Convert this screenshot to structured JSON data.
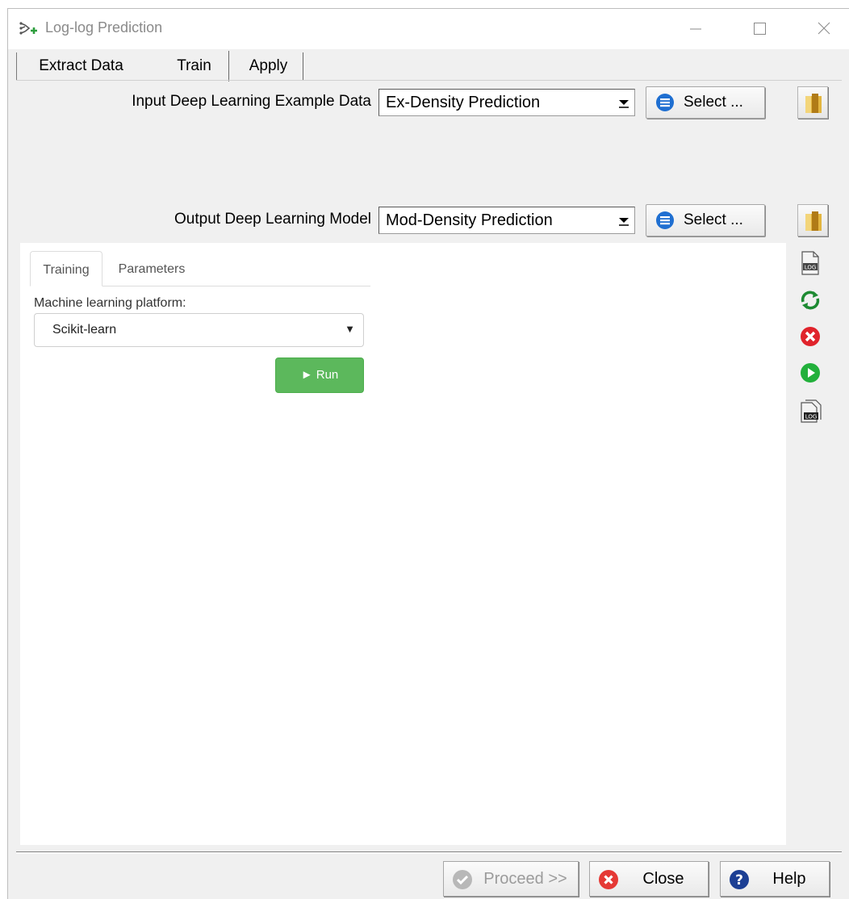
{
  "window": {
    "title": "Log-log Prediction"
  },
  "tabs": [
    {
      "label": "Extract Data"
    },
    {
      "label": "Train"
    },
    {
      "label": "Apply"
    }
  ],
  "input_row": {
    "label": "Input Deep Learning Example Data",
    "value": "Ex-Density Prediction",
    "select_label": "Select ..."
  },
  "output_row": {
    "label": "Output Deep Learning Model",
    "value": "Mod-Density Prediction",
    "select_label": "Select ..."
  },
  "subtabs": [
    {
      "label": "Training"
    },
    {
      "label": "Parameters"
    }
  ],
  "training": {
    "platform_label": "Machine learning platform:",
    "platform_value": "Scikit-learn",
    "run_label": "Run"
  },
  "side_tools": [
    "log-file-icon",
    "refresh-icon",
    "stop-icon",
    "run-icon",
    "log-view-icon"
  ],
  "footer": {
    "proceed_label": "Proceed >>",
    "close_label": "Close",
    "help_label": "Help"
  },
  "colors": {
    "run_green": "#5cb85c",
    "select_blue": "#1f6fd1",
    "close_red": "#e53935",
    "help_navy": "#1c3f94"
  }
}
